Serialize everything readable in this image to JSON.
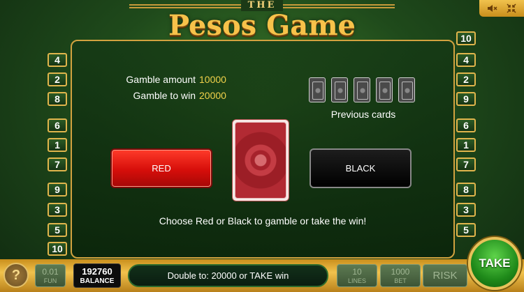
{
  "title": {
    "top": "THE",
    "main": "Pesos Game"
  },
  "system": {
    "sound_icon": "mute-speaker-icon",
    "fullscreen_icon": "collapse-arrows-icon"
  },
  "left_numbers": [
    "4",
    "2",
    "8",
    "6",
    "1",
    "7",
    "9",
    "3",
    "5",
    "10"
  ],
  "right_numbers": [
    "10",
    "4",
    "2",
    "9",
    "6",
    "1",
    "7",
    "8",
    "3",
    "5"
  ],
  "gamble": {
    "amount_label": "Gamble amount",
    "amount_value": "10000",
    "win_label": "Gamble to win",
    "win_value": "20000"
  },
  "previous_cards": {
    "count": 5,
    "label": "Previous cards"
  },
  "buttons": {
    "red": "RED",
    "black": "BLACK",
    "take": "TAKE",
    "help": "?"
  },
  "instruction": "Choose Red or Black to gamble or take the win!",
  "bottom": {
    "fun_value": "0.01",
    "fun_label": "FUN",
    "balance_value": "192760",
    "balance_label": "BALANCE",
    "message": "Double to: 20000 or TAKE win",
    "lines_value": "10",
    "lines_label": "LINES",
    "bet_value": "1000",
    "bet_label": "BET",
    "risk_label": "RISK"
  },
  "colors": {
    "accent_gold": "#e0b54c",
    "red_button": "#d60e0a",
    "take_green": "#1f8a1a",
    "value_yellow": "#f1d24a"
  }
}
